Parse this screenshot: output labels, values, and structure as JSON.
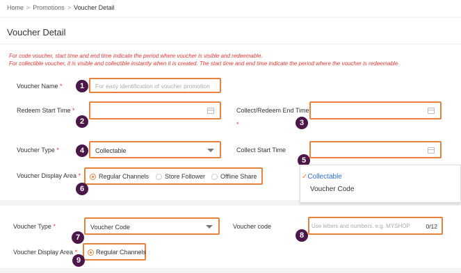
{
  "breadcrumb": {
    "home": "Home",
    "sep1": ">",
    "promotions": "Promotions",
    "sep2": ">",
    "current": "Voucher Detail"
  },
  "page_title": "Voucher Detail",
  "notes": {
    "line1": "For code voucher, start time and end time indicate the period where voucher is visible and redeemable.",
    "line2": "For collectible voucher, it is visible and collectible instantly when it is created. The start time and end time indicate the period where the voucher is redeemable"
  },
  "required_mark": "*",
  "form1": {
    "voucher_name_label": "Voucher Name",
    "voucher_name_placeholder": "For easy identification of voucher promotion",
    "redeem_start_label": "Redeem Start Time",
    "collect_redeem_end_label": "Collect/Redeem End Time",
    "voucher_type_label": "Voucher Type",
    "voucher_type_value": "Collectable",
    "collect_start_label": "Collect Start Time",
    "display_area_label": "Voucher Display Area",
    "radio_regular": "Regular Channels",
    "radio_store": "Store Follower",
    "radio_offline": "Offline Share",
    "dropdown_options": [
      "Collectable",
      "Voucher Code"
    ],
    "selected_check": "✓"
  },
  "form2": {
    "voucher_type_label": "Voucher Type",
    "voucher_type_value": "Voucher Code",
    "voucher_code_label": "Voucher code",
    "voucher_code_placeholder": "Use letters and numbers. e.g. MYSHOP",
    "voucher_code_counter": "0/12",
    "display_area_label": "Voucher Display Area",
    "radio_regular": "Regular Channels"
  },
  "badges": [
    "1",
    "2",
    "3",
    "4",
    "5",
    "6",
    "7",
    "8",
    "9"
  ],
  "colors": {
    "highlight": "#e8813a",
    "badge": "#4a1748",
    "required": "#e53935",
    "link": "#2a6fd1"
  }
}
